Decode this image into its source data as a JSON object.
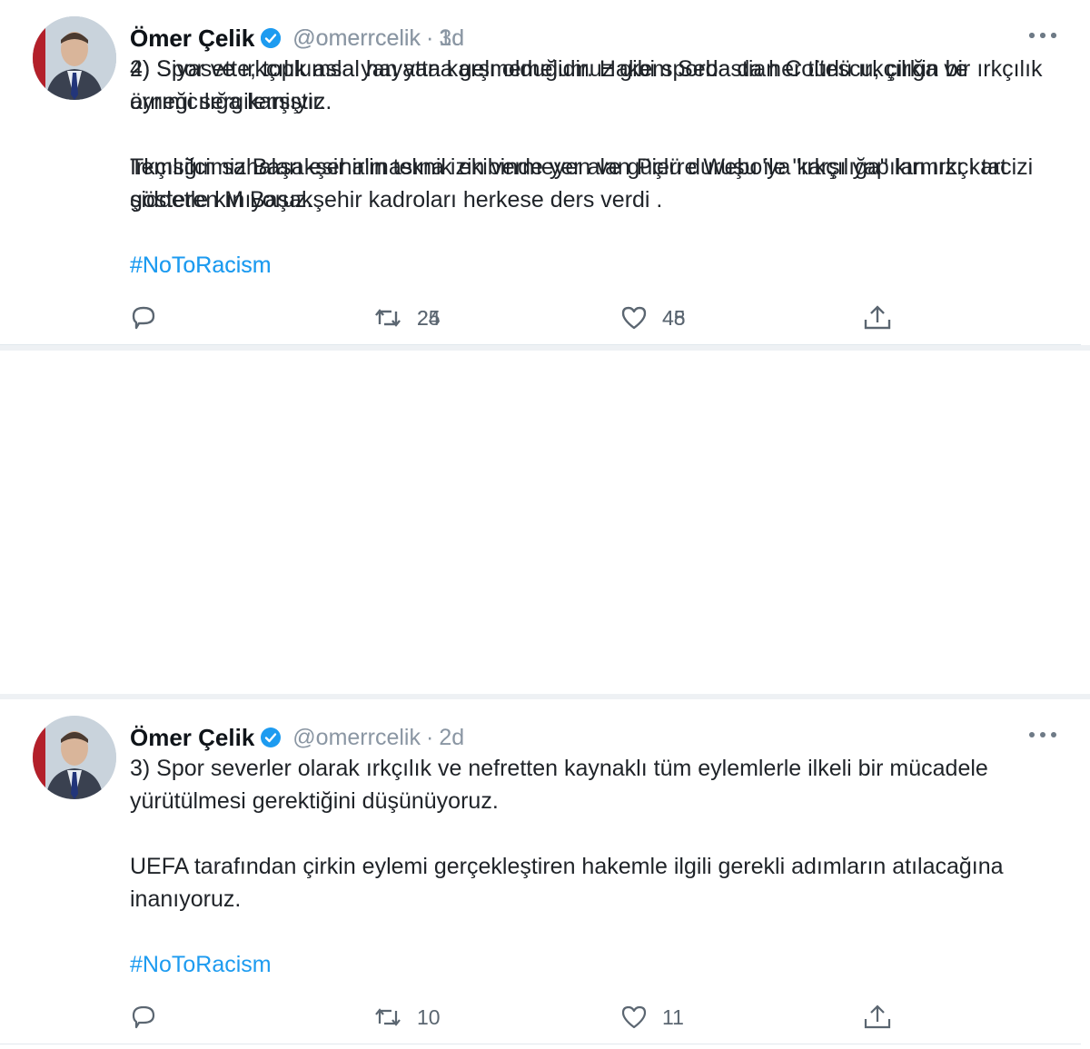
{
  "colors": {
    "link": "#1d9bf0",
    "verified": "#1d9bf0",
    "muted": "#8a96a3",
    "text": "#1f2328"
  },
  "icons": {
    "reply": "speech-bubble-icon",
    "retweet": "retweet-arrows-icon",
    "like": "heart-icon",
    "share": "upload-share-icon",
    "more": "ellipsis-icon",
    "verified": "verified-badge-icon"
  },
  "tweets": [
    {
      "author_name": "Ömer Çelik",
      "handle": "@omerrcelik",
      "separator": "·",
      "time": "1d",
      "paragraphs": [
        "4) Siyasette, toplumsal hayatta karşı olduğumuz gibi sporda da her türlü ırkçılığa ve ayrımcılığa karşıyız.",
        "Temsilcimiz Başakşehir'in teknik ekibinde yer alan Pierre Webo'ya karşı yapılan ırkçı tacizi şiddetle kınıyoruz."
      ],
      "hashtag": "#NoToRacism",
      "reply_count": "",
      "retweet_count": "25",
      "like_count": "48"
    },
    {
      "author_name": "Ömer Çelik",
      "handle": "@omerrcelik",
      "separator": "·",
      "time": "2d",
      "paragraphs": [
        "3) Spor severler olarak ırkçılık ve nefretten kaynaklı tüm eylemlerle ilkeli bir mücadele yürütülmesi gerektiğini düşünüyoruz.",
        "UEFA tarafından çirkin eylemi gerçekleştiren hakemle ilgili gerekli adımların atılacağına inanıyoruz."
      ],
      "hashtag": "#NoToRacism",
      "reply_count": "",
      "retweet_count": "10",
      "like_count": "11"
    },
    {
      "author_name": "Ömer Çelik",
      "handle": "@omerrcelik",
      "separator": "·",
      "time": "3d",
      "paragraphs": [
        "2) Spor ve ırkçılık asla yan yana gelmemelidir. Hakem Sebastian Coltescu, çirkin bir ırkçılık örneği sergilemiştir.",
        "Irkçılığın sahaları esir almasına izin vermeyen ve güçlü duruşu ile \"ırkçılığa\" kırmızı kart gösteren M Başakşehir kadroları herkese ders verdi ."
      ],
      "hashtag": "#NoToRacism",
      "reply_count": "",
      "retweet_count": "24",
      "like_count": "45"
    }
  ]
}
